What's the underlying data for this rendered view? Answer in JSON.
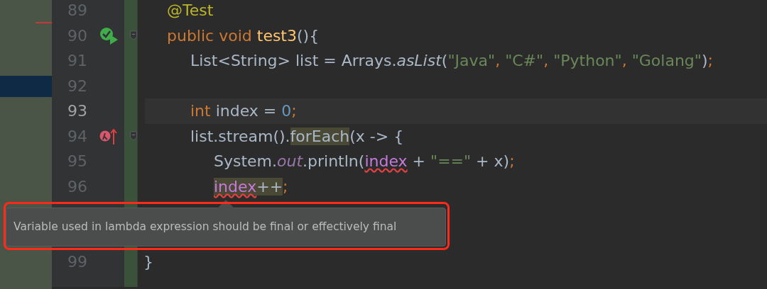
{
  "editor": {
    "lines": [
      {
        "number": "89",
        "kind": "code",
        "current": false,
        "fold": false,
        "tokens": [
          {
            "kind": "annotation",
            "text": "\t@Test"
          }
        ]
      },
      {
        "number": "90",
        "kind": "test-method",
        "current": false,
        "fold": true,
        "tokens": [
          {
            "kind": "keyword",
            "text": "\tpublic void "
          },
          {
            "kind": "method",
            "text": "test3"
          },
          {
            "kind": "plain",
            "text": "(){"
          }
        ]
      },
      {
        "number": "91",
        "kind": "code",
        "current": false,
        "fold": false,
        "tokens": [
          {
            "kind": "plain",
            "text": "\t\tList<String> list = Arrays."
          },
          {
            "kind": "italic",
            "text": "asList"
          },
          {
            "kind": "plain",
            "text": "("
          },
          {
            "kind": "string",
            "text": "\"Java\""
          },
          {
            "kind": "punct",
            "text": ", "
          },
          {
            "kind": "string",
            "text": "\"C#\""
          },
          {
            "kind": "punct",
            "text": ", "
          },
          {
            "kind": "string",
            "text": "\"Python\""
          },
          {
            "kind": "punct",
            "text": ", "
          },
          {
            "kind": "string",
            "text": "\"Golang\""
          },
          {
            "kind": "plain",
            "text": ")"
          },
          {
            "kind": "punct",
            "text": ";"
          }
        ]
      },
      {
        "number": "92",
        "kind": "code",
        "current": false,
        "fold": false
      },
      {
        "number": "93",
        "kind": "code",
        "current": true,
        "fold": false,
        "tokens": [
          {
            "kind": "keyword",
            "text": "\t\tint "
          },
          {
            "kind": "plain",
            "text": "index = "
          },
          {
            "kind": "number",
            "text": "0"
          },
          {
            "kind": "punct",
            "text": ";"
          }
        ]
      },
      {
        "number": "94",
        "kind": "lambda",
        "current": false,
        "fold": true,
        "tokens": [
          {
            "kind": "plain",
            "text": "\t\tlist.stream()."
          },
          {
            "kind": "highlight",
            "text": "forEach"
          },
          {
            "kind": "plain",
            "text": "(x -> {"
          }
        ]
      },
      {
        "number": "95",
        "kind": "code",
        "current": false,
        "fold": false,
        "tokens": [
          {
            "kind": "plain",
            "text": "\t\t\tSystem."
          },
          {
            "kind": "field",
            "text": "out"
          },
          {
            "kind": "plain",
            "text": ".println("
          },
          {
            "kind": "error",
            "text": "index"
          },
          {
            "kind": "plain",
            "text": " + "
          },
          {
            "kind": "string",
            "text": "\"==\""
          },
          {
            "kind": "plain",
            "text": " + x)"
          },
          {
            "kind": "punct",
            "text": ";"
          }
        ]
      },
      {
        "number": "96",
        "kind": "code",
        "current": false,
        "fold": false,
        "tokens": [
          {
            "kind": "error-highlight",
            "text": "\t\t\tindex"
          },
          {
            "kind": "highlight",
            "text": "++"
          },
          {
            "kind": "punct",
            "text": ";"
          }
        ]
      }
    ],
    "lines_below_tooltip": [
      {
        "number": "99",
        "current": false,
        "fold": false,
        "tokens": [
          {
            "kind": "plain",
            "text": "}"
          }
        ]
      }
    ],
    "tooltip": {
      "text": "Variable used in lambda expression should be final or effectively final"
    }
  }
}
